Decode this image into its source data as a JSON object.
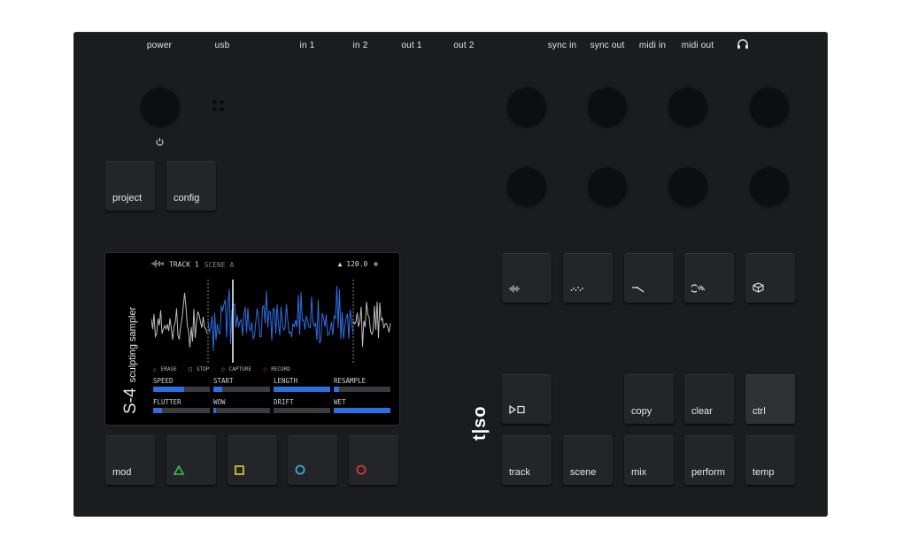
{
  "ports": {
    "power": "power",
    "usb": "usb",
    "in1": "in 1",
    "in2": "in 2",
    "out1": "out 1",
    "out2": "out 2",
    "sync_in": "sync in",
    "sync_out": "sync out",
    "midi_in": "midi in",
    "midi_out": "midi out",
    "headphones_icon": "headphones-icon"
  },
  "buttons": {
    "project": "project",
    "config": "config",
    "mod": "mod",
    "copy": "copy",
    "clear": "clear",
    "ctrl": "ctrl",
    "track": "track",
    "scene": "scene",
    "mix": "mix",
    "perform": "perform",
    "temp": "temp"
  },
  "pad_colors": {
    "triangle": "#3fc24a",
    "square": "#e4d23a",
    "circle_blue": "#3fb6d8",
    "circle_red": "#e23a3a"
  },
  "screen": {
    "brand_model": "S-4",
    "brand_sub": "sculpting sampler",
    "track": "TRACK 1",
    "scene": "SCENE A",
    "bpm": "120.0",
    "legend": {
      "erase": "ERASE",
      "stop": "STOP",
      "capture": "CAPTURE",
      "record": "RECORD"
    },
    "params": [
      {
        "label": "SPEED",
        "value": 0.55
      },
      {
        "label": "START",
        "value": 0.15
      },
      {
        "label": "LENGTH",
        "value": 1.0
      },
      {
        "label": "RESAMPLE",
        "value": 0.1
      },
      {
        "label": "FLUTTER",
        "value": 0.15
      },
      {
        "label": "WOW",
        "value": 0.05
      },
      {
        "label": "DRIFT",
        "value": 0.0
      },
      {
        "label": "WET",
        "value": 1.0
      }
    ]
  },
  "logo": "t|so"
}
